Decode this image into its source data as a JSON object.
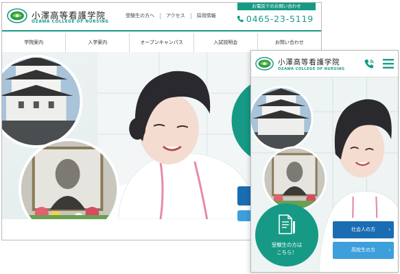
{
  "desktop": {
    "school_name": "小澤高等看護学院",
    "school_name_en": "OZAWA COLLEGE OF NURSING",
    "top_links": [
      "受験生の方へ",
      "アクセス",
      "採用情報"
    ],
    "phone_banner": "お電話でのお問い合わせ",
    "phone_number": "0465-23-5119",
    "nav": [
      "学院案内",
      "入学案内",
      "オープンキャンパス",
      "入試説明会",
      "お問い合わせ"
    ]
  },
  "mobile": {
    "school_name": "小澤高等看護学院",
    "school_name_en": "OZAWA COLLEGE OF NURSING",
    "cta_label": "受験生の方は\nこちら！",
    "buttons": [
      {
        "label": "社会人の方"
      },
      {
        "label": "高校生の方"
      }
    ],
    "chevron": "›"
  },
  "icons": {
    "logo": "leaf-emblem-icon",
    "phone": "phone-icon",
    "menu": "hamburger-menu-icon",
    "document": "document-pen-icon"
  },
  "colors": {
    "brand": "#169a85",
    "button_dark_blue": "#1a6db3",
    "button_light_blue": "#3d9fdc"
  }
}
